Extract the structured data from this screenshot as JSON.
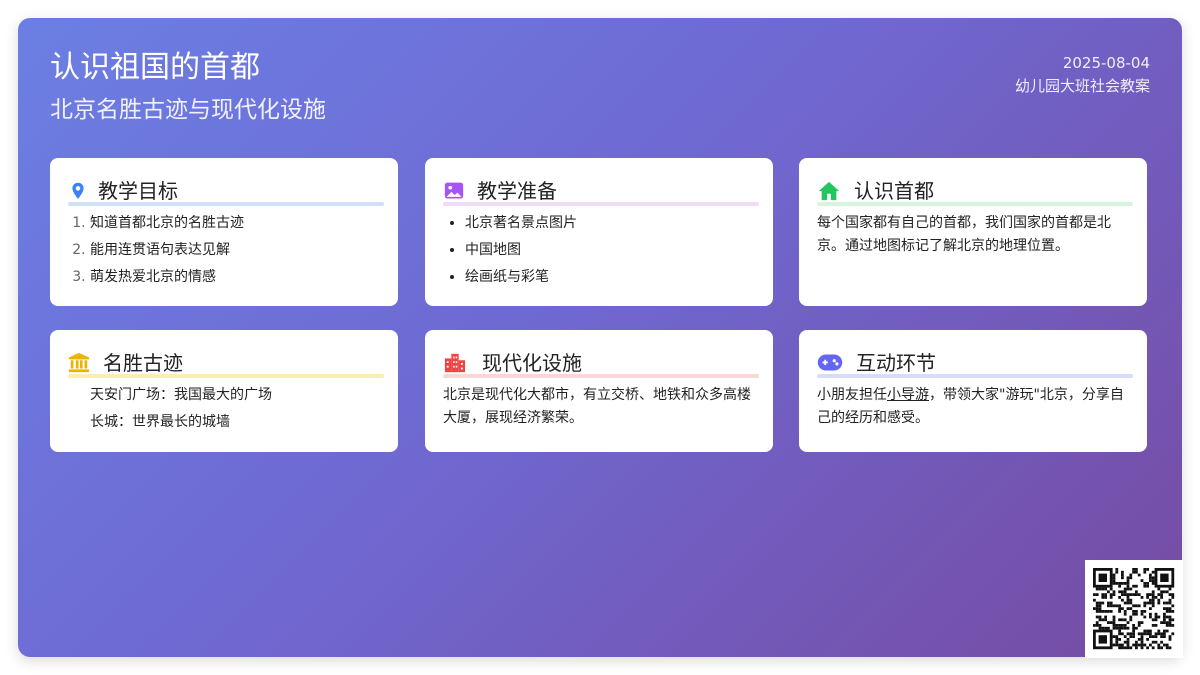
{
  "header": {
    "title": "认识祖国的首都",
    "subtitle": "北京名胜古迹与现代化设施",
    "date": "2025-08-04",
    "course": "幼儿园大班社会教案"
  },
  "cards": {
    "goals": {
      "title": "教学目标",
      "items": [
        "知道首都北京的名胜古迹",
        "能用连贯语句表达见解",
        "萌发热爱北京的情感"
      ],
      "icon": "map-pin-icon",
      "color": "#3b82f6"
    },
    "prep": {
      "title": "教学准备",
      "items": [
        "北京著名景点图片",
        "中国地图",
        "绘画纸与彩笔"
      ],
      "icon": "image-icon",
      "color": "#a855f7"
    },
    "capital": {
      "title": "认识首都",
      "text": "每个国家都有自己的首都，我们国家的首都是北京。通过地图标记了解北京的地理位置。",
      "icon": "home-icon",
      "color": "#22c55e"
    },
    "sites": {
      "title": "名胜古迹",
      "items": [
        "天安门广场：我国最大的广场",
        "长城：世界最长的城墙"
      ],
      "icon": "landmark-icon",
      "color": "#eab308"
    },
    "modern": {
      "title": "现代化设施",
      "text": "北京是现代化大都市，有立交桥、地铁和众多高楼大厦，展现经济繁荣。",
      "icon": "city-icon",
      "color": "#ef4444"
    },
    "interactive": {
      "title": "互动环节",
      "text_before": "小朋友担任",
      "text_link": "小导游",
      "text_after": "，带领大家\"游玩\"北京，分享自己的经历和感受。",
      "icon": "gamepad-icon",
      "color": "#6366f1"
    }
  }
}
